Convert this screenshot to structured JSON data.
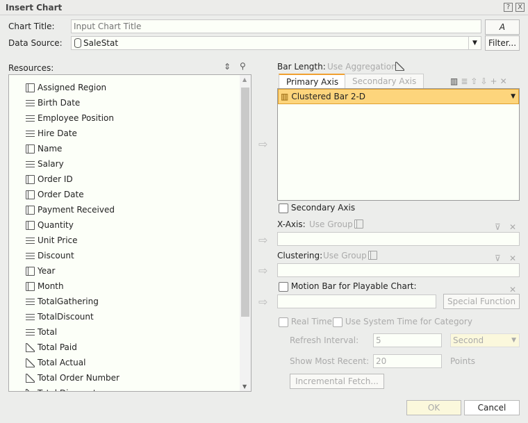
{
  "dialog": {
    "title": "Insert Chart",
    "help_icon": "?",
    "close_icon": "X"
  },
  "chart_title": {
    "label": "Chart Title:",
    "placeholder": "Input Chart Title",
    "format_button": "A"
  },
  "data_source": {
    "label": "Data Source:",
    "value": "SaleStat",
    "filter_button": "Filter..."
  },
  "resources": {
    "label": "Resources:",
    "items": [
      {
        "label": "Assigned Region",
        "icon": "table"
      },
      {
        "label": "Birth Date",
        "icon": "field"
      },
      {
        "label": "Employee Position",
        "icon": "field"
      },
      {
        "label": "Hire Date",
        "icon": "field"
      },
      {
        "label": "Name",
        "icon": "table"
      },
      {
        "label": "Salary",
        "icon": "field"
      },
      {
        "label": "Order ID",
        "icon": "table"
      },
      {
        "label": "Order Date",
        "icon": "table"
      },
      {
        "label": "Payment Received",
        "icon": "table"
      },
      {
        "label": "Quantity",
        "icon": "table"
      },
      {
        "label": "Unit Price",
        "icon": "field"
      },
      {
        "label": "Discount",
        "icon": "field"
      },
      {
        "label": "Year",
        "icon": "table"
      },
      {
        "label": "Month",
        "icon": "table"
      },
      {
        "label": "TotalGathering",
        "icon": "field"
      },
      {
        "label": "TotalDiscount",
        "icon": "field"
      },
      {
        "label": "Total",
        "icon": "field"
      },
      {
        "label": "Total Paid",
        "icon": "agg"
      },
      {
        "label": "Total Actual",
        "icon": "agg"
      },
      {
        "label": "Total Order Number",
        "icon": "agg"
      },
      {
        "label": "Total Discount",
        "icon": "agg"
      }
    ]
  },
  "bar_length": {
    "label": "Bar Length:",
    "hint": "Use Aggregation"
  },
  "tabs": [
    {
      "label": "Primary Axis",
      "active": true
    },
    {
      "label": "Secondary Axis",
      "active": false
    }
  ],
  "chart_type": {
    "value": "Clustered Bar 2-D",
    "accent": "#fdd57c"
  },
  "secondary_axis": {
    "label": "Secondary Axis",
    "checked": false
  },
  "x_axis": {
    "label": "X-Axis:",
    "hint": "Use Group"
  },
  "clustering": {
    "label": "Clustering:",
    "hint": "Use Group"
  },
  "motion_bar": {
    "label": "Motion Bar for Playable Chart:",
    "checked": false,
    "special_button": "Special Function"
  },
  "real_time": {
    "label": "Real Time",
    "checked": false,
    "system_time_label": "Use System Time for Category",
    "refresh_label": "Refresh Interval:",
    "refresh_value": "5",
    "unit": "Second",
    "recent_label": "Show Most Recent:",
    "recent_value": "20",
    "points": "Points",
    "fetch_button": "Incremental Fetch..."
  },
  "footer": {
    "ok": "OK",
    "cancel": "Cancel"
  }
}
